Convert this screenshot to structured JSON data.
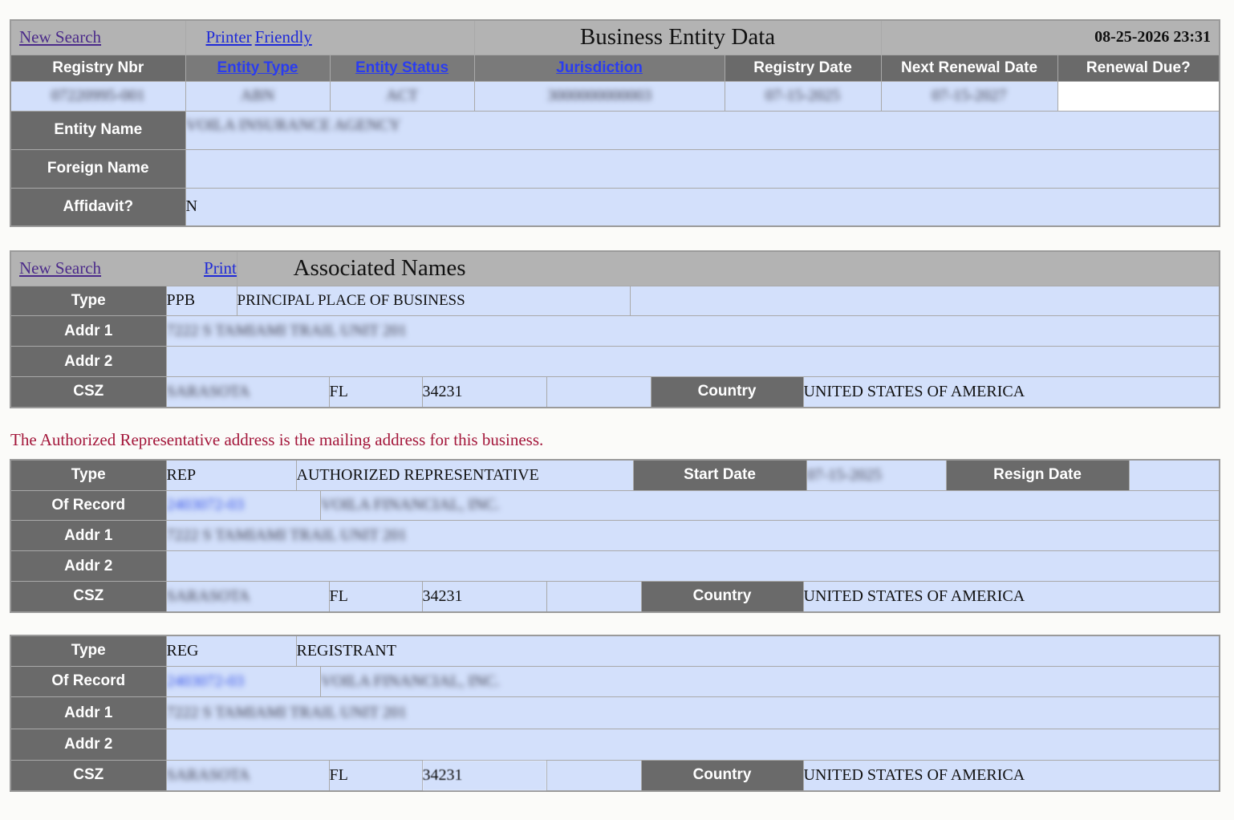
{
  "nav": {
    "new_search": "New Search",
    "printer_friendly_1": "Printer",
    "printer_friendly_2": "Friendly"
  },
  "entity": {
    "title": "Business Entity Data",
    "timestamp": "08-25-2026 23:31",
    "columns": [
      "Registry Nbr",
      "Entity Type",
      "Entity Status",
      "Jurisdiction",
      "Registry Date",
      "Next Renewal Date",
      "Renewal Due?"
    ],
    "values": {
      "registry_nbr": "07220995-001",
      "entity_type": "ABN",
      "entity_status": "ACT",
      "jurisdiction": "3000000000003",
      "registry_date": "07-15-2025",
      "next_renewal_date": "07-15-2027",
      "renewal_due": ""
    },
    "entity_name_label": "Entity Name",
    "entity_name": "VOILA INSURANCE AGENCY",
    "foreign_name_label": "Foreign Name",
    "foreign_name": "",
    "affidavit_label": "Affidavit?",
    "affidavit": "N"
  },
  "associated": {
    "title": "Associated Names",
    "labels": {
      "type": "Type",
      "of_record": "Of Record",
      "addr1": "Addr 1",
      "addr2": "Addr 2",
      "csz": "CSZ",
      "country": "Country",
      "start_date": "Start Date",
      "resign_date": "Resign Date"
    },
    "ppb": {
      "type_code": "PPB",
      "type_desc": "PRINCIPAL PLACE OF BUSINESS",
      "addr1": "7222 S TAMIAMI TRAIL UNIT 201",
      "addr2": "",
      "city": "SARASOTA",
      "state": "FL",
      "zip": "34231",
      "country": "UNITED STATES OF AMERICA"
    },
    "notice": "The Authorized Representative address is the mailing address for this business.",
    "rep": {
      "type_code": "REP",
      "type_desc": "AUTHORIZED REPRESENTATIVE",
      "start_date": "07-15-2025",
      "resign_date": "",
      "record_id": "2403072-03",
      "record_name": "VOILA FINANCIAL, INC.",
      "addr1": "7222 S TAMIAMI TRAIL UNIT 201",
      "addr2": "",
      "city": "SARASOTA",
      "state": "FL",
      "zip": "34231",
      "country": "UNITED STATES OF AMERICA"
    },
    "reg": {
      "type_code": "REG",
      "type_desc": "REGISTRANT",
      "record_id": "2403072-03",
      "record_name": "VOILA FINANCIAL, INC.",
      "addr1": "7222 S TAMIAMI TRAIL UNIT 201",
      "addr2": "",
      "city": "SARASOTA",
      "state": "FL",
      "zip": "34231",
      "country": "UNITED STATES OF AMERICA"
    }
  },
  "colors": {
    "header_bar": "#b3b3b3",
    "label_cell": "#6a6a6a",
    "value_cell": "#d3e0fb",
    "link": "#1f2ad8",
    "notice": "#a3163a"
  }
}
